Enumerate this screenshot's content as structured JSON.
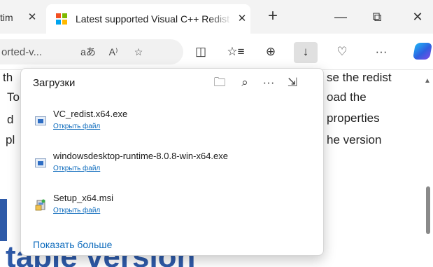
{
  "tabs": [
    {
      "title": "tim",
      "close": "✕"
    },
    {
      "title": "Latest supported Visual C++ Redist",
      "close": "✕"
    }
  ],
  "tabstrip": {
    "new_tab": "+",
    "minimize": "—",
    "restore": "⧉",
    "close": "✕"
  },
  "address": {
    "text": "orted-v...",
    "read_aloud_icon": "aあ",
    "voice_icon": "A⁾",
    "favorite_icon": "☆"
  },
  "toolbar_icons": {
    "split": "◫",
    "favorites": "☆≡",
    "collections": "⊕",
    "downloads": "↓",
    "health": "♡",
    "more": "···"
  },
  "page": {
    "lines": [
      {
        "left": "th",
        "right": "se the redist"
      },
      {
        "left": "To",
        "right": "oad the"
      },
      {
        "left": "d",
        "right": "properties"
      },
      {
        "left": "pl",
        "right": "he version"
      }
    ],
    "heading_partial": "table version"
  },
  "downloads": {
    "title": "Загрузки",
    "icons": {
      "folder": "🗀",
      "search": "⌕",
      "more": "···",
      "pin": "⇲"
    },
    "items": [
      {
        "name": "VC_redist.x64.exe",
        "action": "Открыть файл",
        "kind": "exe"
      },
      {
        "name": "windowsdesktop-runtime-8.0.8-win-x64.exe",
        "action": "Открыть файл",
        "kind": "exe"
      },
      {
        "name": "Setup_x64.msi",
        "action": "Открыть файл",
        "kind": "msi"
      }
    ],
    "show_more": "Показать больше"
  },
  "colors": {
    "accent": "#0f6cbd",
    "heading": "#2e5aa8",
    "ms_red": "#f25022",
    "ms_green": "#7fba00",
    "ms_blue": "#00a4ef",
    "ms_yellow": "#ffb900"
  }
}
